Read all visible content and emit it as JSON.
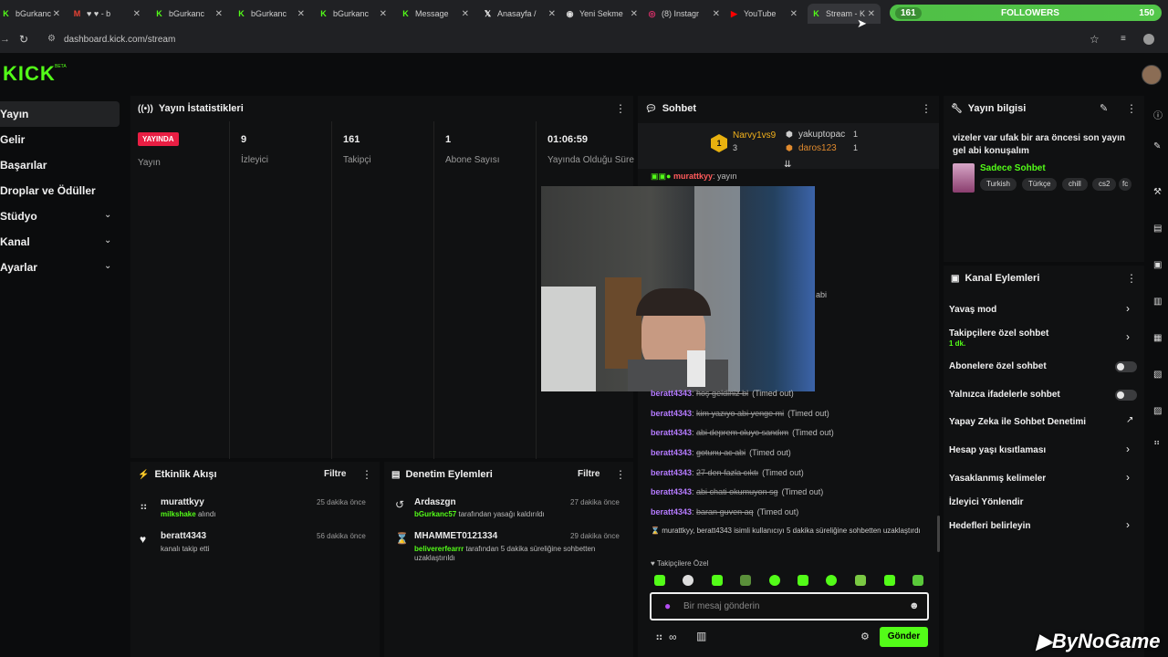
{
  "browser": {
    "tabs": [
      {
        "label": "bGurkanc",
        "icon": "kick-favicon"
      },
      {
        "label": "♥ ♥ - b",
        "icon": "gmail-favicon"
      },
      {
        "label": "bGurkanc",
        "icon": "kick-favicon"
      },
      {
        "label": "bGurkanc",
        "icon": "kick-favicon"
      },
      {
        "label": "bGurkanc",
        "icon": "kick-favicon"
      },
      {
        "label": "Message",
        "icon": "kick-favicon"
      },
      {
        "label": "Anasayfa /",
        "icon": "x-favicon"
      },
      {
        "label": "Yeni Sekme",
        "icon": "chrome-favicon"
      },
      {
        "label": "(8) Instagr",
        "icon": "instagram-favicon"
      },
      {
        "label": "YouTube",
        "icon": "youtube-favicon"
      },
      {
        "label": "Stream - K",
        "icon": "kick-favicon"
      }
    ],
    "url": "dashboard.kick.com/stream"
  },
  "follower_goal": {
    "current": "161",
    "label": "FOLLOWERS",
    "goal": "150"
  },
  "brand": {
    "logo": "KICK",
    "beta": "BETA"
  },
  "sidebar": {
    "items": [
      {
        "label": "Yayın",
        "active": true
      },
      {
        "label": "Gelir"
      },
      {
        "label": "Başarılar"
      },
      {
        "label": "Droplar ve Ödüller"
      },
      {
        "label": "Stüdyo",
        "expandable": true
      },
      {
        "label": "Kanal",
        "expandable": true
      },
      {
        "label": "Ayarlar",
        "expandable": true
      }
    ]
  },
  "stats_panel": {
    "title": "Yayın İstatistikleri",
    "live_badge": "YAYINDA",
    "live_label": "Yayın",
    "stats": [
      {
        "value": "9",
        "label": "İzleyici"
      },
      {
        "value": "161",
        "label": "Takipçi"
      },
      {
        "value": "1",
        "label": "Abone Sayısı"
      },
      {
        "value": "01:06:59",
        "label": "Yayında Olduğu Süre"
      }
    ]
  },
  "activity": {
    "title": "Etkinlik Akışı",
    "filter": "Filtre",
    "items": [
      {
        "user": "murattkyy",
        "detail_hl": "milkshake",
        "detail": "alındı",
        "time": "25 dakika önce"
      },
      {
        "user": "beratt4343",
        "detail_hl": "",
        "detail": "kanalı takip etti",
        "time": "56 dakika önce"
      }
    ]
  },
  "moderation": {
    "title": "Denetim Eylemleri",
    "filter": "Filtre",
    "items": [
      {
        "user": "Ardaszgn",
        "detail_hl": "bGurkanc57",
        "detail": "tarafından yasağı kaldırıldı",
        "time": "27 dakika önce"
      },
      {
        "user": "MHAMMET0121334",
        "detail_hl": "belivererfearrr",
        "detail": "tarafından 5 dakika süreliğine sohbetten uzaklaştırıldı",
        "time": "29 dakika önce"
      }
    ]
  },
  "chat": {
    "title": "Sohbet",
    "top_users": [
      {
        "name": "Narvy1vs9",
        "count": "3"
      },
      {
        "name": "yakuptopac",
        "count": "1"
      },
      {
        "name": "daros123",
        "count": "1"
      }
    ],
    "first_line": {
      "user": "murattkyy",
      "text": "yayın"
    },
    "overlay_partial": "abi",
    "lines": [
      {
        "user": "beratt4343",
        "text": "hoş geldiniz bl",
        "tag": "(Timed out)"
      },
      {
        "user": "beratt4343",
        "text": "kim yazıyo abi yenge mi",
        "tag": "(Timed out)"
      },
      {
        "user": "beratt4343",
        "text": "abi deprem oluyo sandım",
        "tag": "(Timed out)"
      },
      {
        "user": "beratt4343",
        "text": "gotunu ac abi",
        "tag": "(Timed out)"
      },
      {
        "user": "beratt4343",
        "text": "27 den fazla cıktı",
        "tag": "(Timed out)"
      },
      {
        "user": "beratt4343",
        "text": "abi chati okumuyon sg",
        "tag": "(Timed out)"
      },
      {
        "user": "beratt4343",
        "text": "baran guven aq",
        "tag": "(Timed out)"
      }
    ],
    "system_msg": "murattkyy, beratt4343 isimli kullanıcıyı 5 dakika süreliğine sohbetten uzaklaştırdı",
    "followers_only": "Takipçilere Özel",
    "input_placeholder": "Bir mesaj gönderin",
    "send": "Gönder"
  },
  "stream_info": {
    "title": "Yayın bilgisi",
    "description": "vizeler var ufak bir ara öncesi son yayın gel abi konuşalım",
    "category": "Sadece Sohbet",
    "tags": [
      "Turkish",
      "Türkçe",
      "chill",
      "cs2",
      "fc"
    ]
  },
  "channel_actions": {
    "title": "Kanal Eylemleri",
    "items": [
      {
        "label": "Yavaş mod",
        "control": "arrow"
      },
      {
        "label": "Takipçilere özel sohbet",
        "sub": "1 dk.",
        "control": "arrow"
      },
      {
        "label": "Abonelere özel sohbet",
        "control": "toggle"
      },
      {
        "label": "Yalnızca ifadelerle sohbet",
        "control": "toggle"
      },
      {
        "label": "Yapay Zeka ile Sohbet Denetimi",
        "control": "external"
      },
      {
        "label": "Hesap yaşı kısıtlaması",
        "control": "arrow"
      },
      {
        "label": "Yasaklanmış kelimeler",
        "control": "arrow"
      },
      {
        "label": "İzleyici Yönlendir",
        "control": "none"
      },
      {
        "label": "Hedefleri belirleyin",
        "control": "arrow"
      }
    ]
  },
  "watermark": "ByNoGame",
  "colors": {
    "kick_green": "#53fc18",
    "live_red": "#e91e43",
    "username_purple": "#b57bff"
  }
}
